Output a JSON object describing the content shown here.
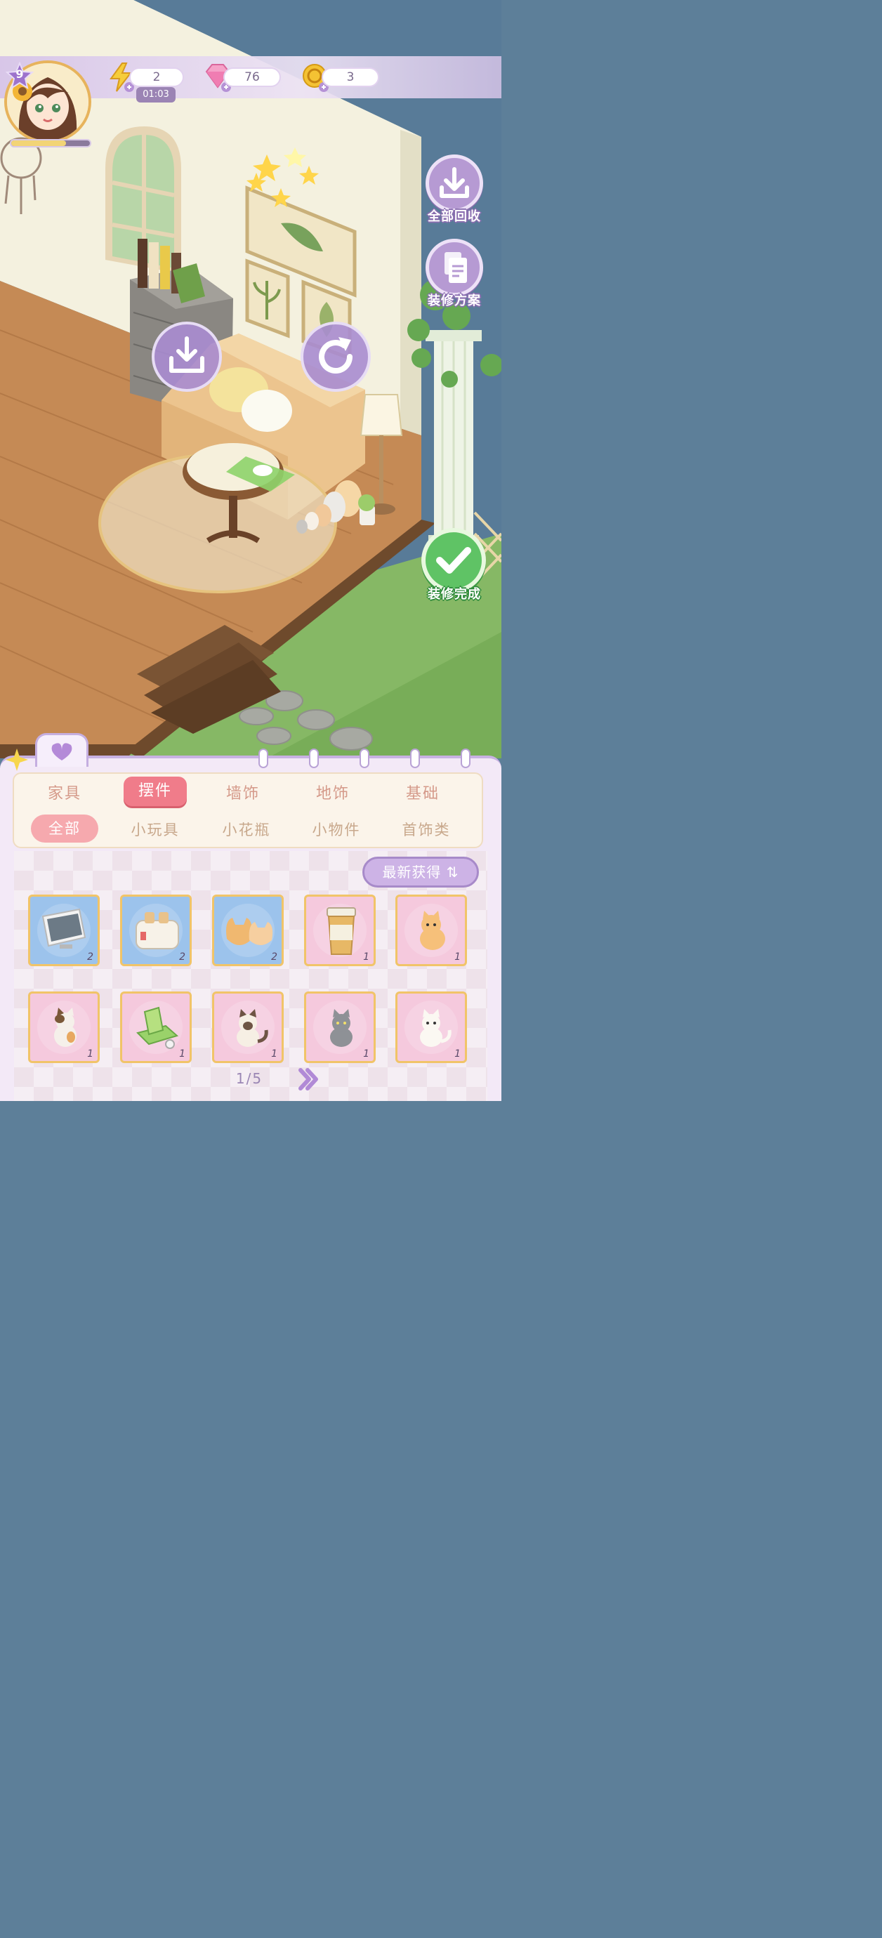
{
  "hud": {
    "level": "9",
    "xp_fraction": 0.7,
    "energy": "2",
    "energy_timer": "01:03",
    "gems": "76",
    "coins": "3"
  },
  "side_buttons": {
    "recycle_all": "全部回收",
    "decor_plan": "装修方案",
    "finish": "装修完成"
  },
  "panel": {
    "main_tabs": [
      "家具",
      "摆件",
      "墙饰",
      "地饰",
      "基础"
    ],
    "sub_tabs": [
      "全部",
      "小玩具",
      "小花瓶",
      "小物件",
      "首饰类"
    ],
    "sort_label": "最新获得",
    "page": "1/5",
    "items": [
      {
        "icon": "tv-icon",
        "count": "2",
        "bg": "#9cc3ec"
      },
      {
        "icon": "toaster-icon",
        "count": "2",
        "bg": "#9cc3ec"
      },
      {
        "icon": "cat-cushion-icon",
        "count": "2",
        "bg": "#9cc3ec"
      },
      {
        "icon": "cup-icon",
        "count": "1",
        "bg": "#f5c9dd"
      },
      {
        "icon": "orange-cat-icon",
        "count": "1",
        "bg": "#f5c9dd"
      },
      {
        "icon": "calico-cat-icon",
        "count": "1",
        "bg": "#f5c9dd"
      },
      {
        "icon": "green-gadget-icon",
        "count": "1",
        "bg": "#f5c9dd"
      },
      {
        "icon": "siamese-cat-icon",
        "count": "1",
        "bg": "#f5c9dd"
      },
      {
        "icon": "gray-cat-icon",
        "count": "1",
        "bg": "#f5c9dd"
      },
      {
        "icon": "white-cat-icon",
        "count": "1",
        "bg": "#f5c9dd"
      }
    ]
  }
}
